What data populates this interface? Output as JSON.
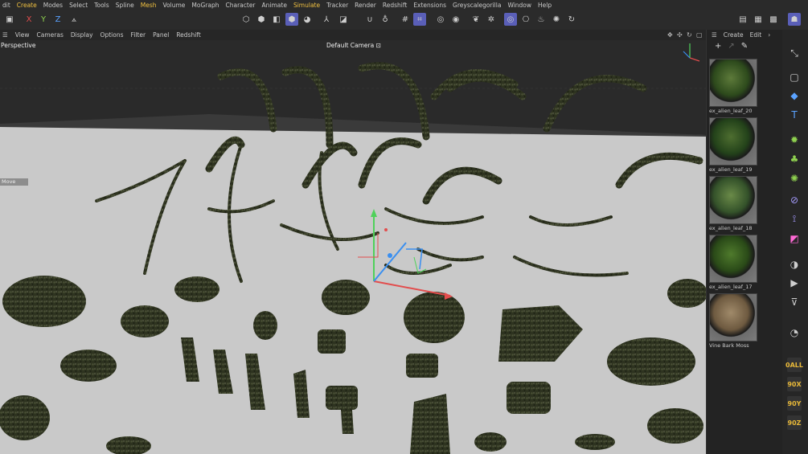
{
  "menu": [
    "dit",
    "Create",
    "Modes",
    "Select",
    "Tools",
    "Spline",
    "Mesh",
    "Volume",
    "MoGraph",
    "Character",
    "Animate",
    "Simulate",
    "Tracker",
    "Render",
    "Redshift",
    "Extensions",
    "Greyscalegorilla",
    "Window",
    "Help"
  ],
  "toolbar": {
    "axes": [
      "X",
      "Y",
      "Z"
    ]
  },
  "viewport_menu": [
    "View",
    "Cameras",
    "Display",
    "Options",
    "Filter",
    "Panel",
    "Redshift"
  ],
  "viewport": {
    "name": "Perspective",
    "camera": "Default Camera ⊡",
    "tool_chip": "Move"
  },
  "panel": {
    "menu": [
      "Create",
      "Edit"
    ],
    "materials": [
      {
        "name": "ex_alien_leaf_20"
      },
      {
        "name": "ex_alien_leaf_19"
      },
      {
        "name": "ex_alien_leaf_18"
      },
      {
        "name": "ex_alien_leaf_17"
      },
      {
        "name": "Vine Bark Moss"
      }
    ]
  },
  "right_labels": [
    "0ALL",
    "90X",
    "90Y",
    "90Z"
  ],
  "colors": {
    "accent": "#5a5fb8",
    "menu_highlight": "#f0c040",
    "floor": "#c9c9c9",
    "foliage": "#2f3320"
  }
}
